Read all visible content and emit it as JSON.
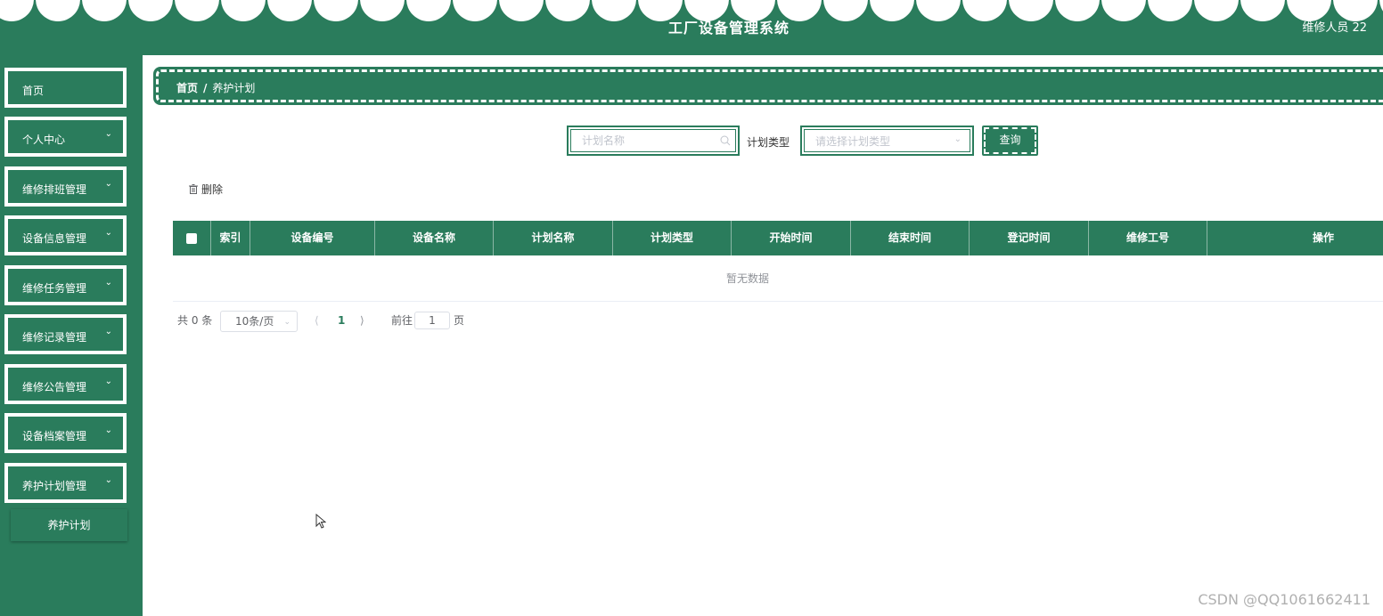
{
  "header": {
    "title": "工厂设备管理系统",
    "user": "维修人员 22"
  },
  "sidebar": {
    "items": [
      {
        "label": "首页",
        "has_submenu": false
      },
      {
        "label": "个人中心",
        "has_submenu": true
      },
      {
        "label": "维修排班管理",
        "has_submenu": true
      },
      {
        "label": "设备信息管理",
        "has_submenu": true
      },
      {
        "label": "维修任务管理",
        "has_submenu": true
      },
      {
        "label": "维修记录管理",
        "has_submenu": true
      },
      {
        "label": "维修公告管理",
        "has_submenu": true
      },
      {
        "label": "设备档案管理",
        "has_submenu": true
      },
      {
        "label": "养护计划管理",
        "has_submenu": true
      }
    ],
    "submenu_item": "养护计划"
  },
  "breadcrumb": {
    "home": "首页",
    "separator": "/",
    "current": "养护计划"
  },
  "search": {
    "name_placeholder": "计划名称",
    "type_label": "计划类型",
    "type_placeholder": "请选择计划类型",
    "query_label": "查询"
  },
  "actions": {
    "delete_label": "删除"
  },
  "table": {
    "columns": [
      "索引",
      "设备编号",
      "设备名称",
      "计划名称",
      "计划类型",
      "开始时间",
      "结束时间",
      "登记时间",
      "维修工号",
      "操作"
    ],
    "empty_text": "暂无数据"
  },
  "pagination": {
    "total": "共 0 条",
    "page_size": "10条/页",
    "current_page": "1",
    "goto_label": "前往",
    "goto_value": "1",
    "page_unit": "页"
  },
  "watermark": "CSDN @QQ1061662411",
  "colors": {
    "primary": "#2a7c5c",
    "background": "#ffffff",
    "placeholder": "#c0c4cc"
  }
}
